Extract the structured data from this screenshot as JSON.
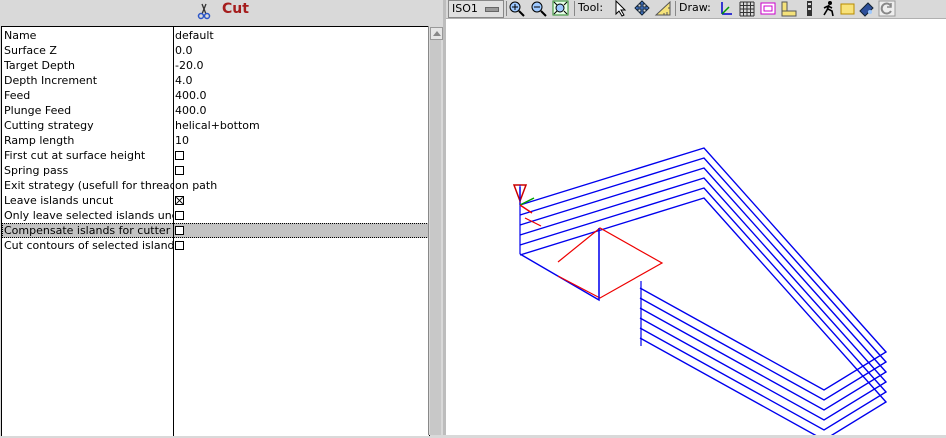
{
  "window": {
    "title": "Cut"
  },
  "properties": [
    {
      "name": "Name",
      "value": "default"
    },
    {
      "name": "Surface Z",
      "value": "0.0"
    },
    {
      "name": "Target Depth",
      "value": "-20.0"
    },
    {
      "name": "Depth Increment",
      "value": "4.0"
    },
    {
      "name": "Feed",
      "value": "400.0"
    },
    {
      "name": "Plunge Feed",
      "value": "400.0"
    },
    {
      "name": "Cutting strategy",
      "value": "helical+bottom"
    },
    {
      "name": "Ramp length",
      "value": "10"
    },
    {
      "name": "First cut at surface height",
      "checkbox": false
    },
    {
      "name": "Spring pass",
      "checkbox": false
    },
    {
      "name": "Exit strategy (usefull for threads)",
      "value": "on path"
    },
    {
      "name": "Leave islands uncut",
      "checkbox": true
    },
    {
      "name": "Only leave selected islands uncut",
      "checkbox": false
    },
    {
      "name": "Compensate islands for cutter",
      "checkbox": false,
      "selected": true
    },
    {
      "name": "Cut contours of selected islands",
      "checkbox": false
    }
  ],
  "toolbar": {
    "view_select": "ISO1",
    "tool_label": "Tool:",
    "draw_label": "Draw:",
    "buttons": {
      "zoom_in": "zoom-in-icon",
      "zoom_out": "zoom-out-icon",
      "zoom_fit": "zoom-fit-icon",
      "select": "pointer-icon",
      "pan": "pan-icon",
      "measure": "ruler-triangle-icon",
      "axis": "axis-icon",
      "grid": "grid-icon",
      "margin": "margin-box-icon",
      "ruler": "ruler-icon",
      "rapid": "rapid-move-icon",
      "walk": "walk-icon",
      "workpiece": "workpiece-icon",
      "camera": "camera-icon",
      "refresh": "refresh-icon"
    }
  },
  "colors": {
    "title": "#a51d1d",
    "toolpath": "#0000ee",
    "rapid": "#ee0000",
    "selected_row": "#c3c3c3"
  }
}
